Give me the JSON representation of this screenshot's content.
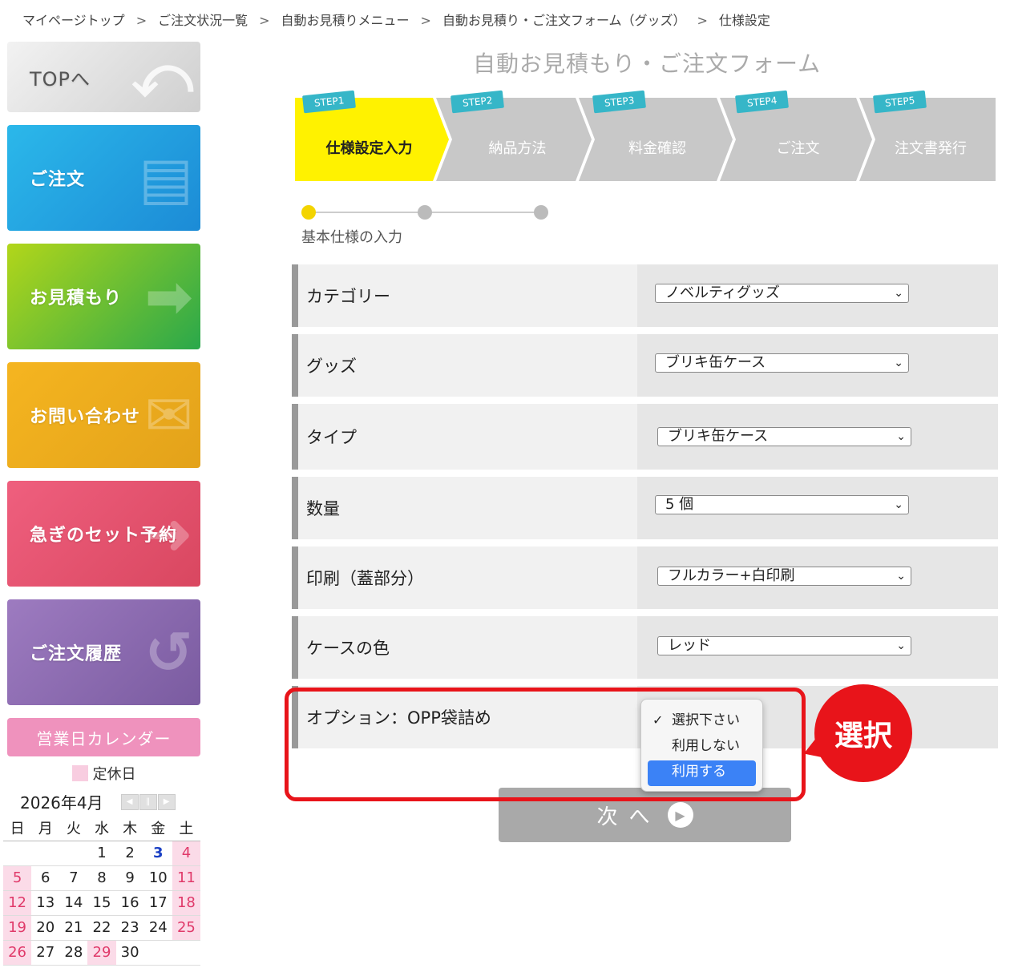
{
  "breadcrumb": [
    "マイページトップ",
    "ご注文状況一覧",
    "自動お見積りメニュー",
    "自動お見積り・ご注文フォーム（グッズ）",
    "仕様設定"
  ],
  "breadcrumb_sep": ">",
  "sidebar": {
    "top": "TOPへ",
    "order": "ご注文",
    "estimate": "お見積もり",
    "contact": "お問い合わせ",
    "rush": "急ぎのセット予約",
    "history": "ご注文履歴"
  },
  "calendar": {
    "title": "営業日カレンダー",
    "legend": "定休日",
    "month": "2026年4月",
    "dow": [
      "日",
      "月",
      "火",
      "水",
      "木",
      "金",
      "土"
    ]
  },
  "main": {
    "title": "自動お見積もり・ご注文フォーム",
    "steps": [
      {
        "tag": "STEP1",
        "label": "仕様設定入力"
      },
      {
        "tag": "STEP2",
        "label": "納品方法"
      },
      {
        "tag": "STEP3",
        "label": "料金確認"
      },
      {
        "tag": "STEP4",
        "label": "ご注文"
      },
      {
        "tag": "STEP5",
        "label": "注文書発行"
      }
    ],
    "progress_label": "基本仕様の入力",
    "fields": [
      {
        "label": "カテゴリー",
        "value": "ノベルティグッズ"
      },
      {
        "label": "グッズ",
        "value": "ブリキ缶ケース"
      },
      {
        "label": "タイプ",
        "value": "ブリキ缶ケース"
      },
      {
        "label": "数量",
        "value": "5 個"
      },
      {
        "label": "印刷（蓋部分）",
        "value": "フルカラー+白印刷"
      },
      {
        "label": "ケースの色",
        "value": "レッド"
      },
      {
        "label": "オプション：OPP袋詰め",
        "value": ""
      }
    ],
    "dropdown_options": [
      "選択下さい",
      "利用しない",
      "利用する"
    ],
    "callout": "選択",
    "next_label": "次へ"
  },
  "colors": {
    "step_active": "#fff200",
    "step_inactive": "#c8c8c8",
    "step_tag": "#36b6c8",
    "highlight": "#e8141a",
    "dropdown_active": "#3b82f6"
  }
}
